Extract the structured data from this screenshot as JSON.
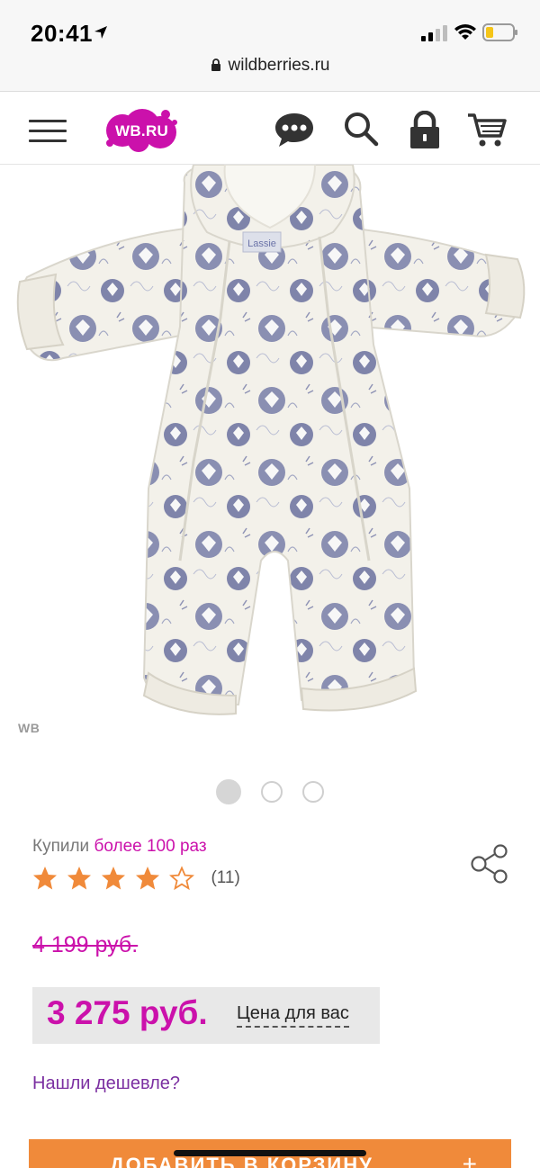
{
  "status_bar": {
    "time": "20:41",
    "url": "wildberries.ru"
  },
  "header": {
    "logo_text": "WB.RU",
    "brand_color": "#cb11ab",
    "icons": [
      "menu-icon",
      "chat-icon",
      "search-icon",
      "lock-icon",
      "cart-icon"
    ]
  },
  "product": {
    "image_watermark": "WB",
    "label_brand": "Lassie",
    "carousel": {
      "count": 3,
      "active": 1
    },
    "bought_prefix": "Купили",
    "bought_value": "более 100 раз",
    "rating": 4,
    "rating_max": 5,
    "reviews_count": "(11)",
    "old_price": "4 199 руб.",
    "new_price": "3 275 руб.",
    "price_for_you": "Цена для вас",
    "found_cheaper": "Нашли дешевле?",
    "add_to_cart": "ДОБАВИТЬ В КОРЗИНУ",
    "add_to_cart_plus": "+",
    "accent_color": "#f08a3a"
  }
}
